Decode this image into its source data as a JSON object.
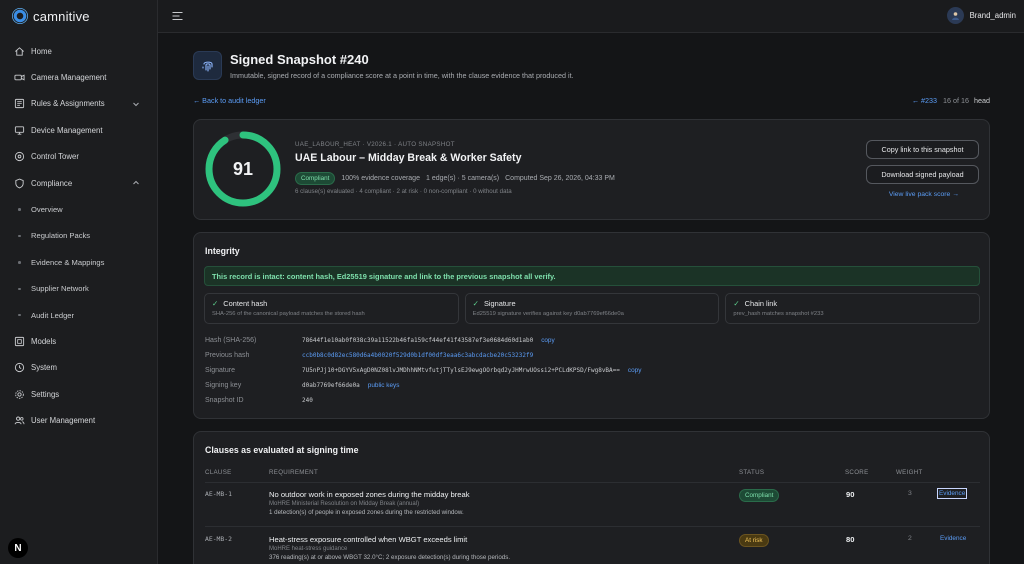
{
  "brand": {
    "name": "camnitive"
  },
  "sidebar": {
    "items": [
      {
        "label": "Home",
        "icon": "home-icon"
      },
      {
        "label": "Camera Management",
        "icon": "camera-icon"
      },
      {
        "label": "Rules & Assignments",
        "icon": "rules-icon",
        "expandable": true
      },
      {
        "label": "Device Management",
        "icon": "device-icon"
      },
      {
        "label": "Control Tower",
        "icon": "control-tower-icon"
      },
      {
        "label": "Compliance",
        "icon": "shield-icon",
        "expanded": true
      },
      {
        "label": "Models",
        "icon": "models-icon"
      },
      {
        "label": "System",
        "icon": "system-icon"
      },
      {
        "label": "Settings",
        "icon": "gear-icon"
      },
      {
        "label": "User Management",
        "icon": "users-icon"
      }
    ],
    "compliance_sub": [
      "Overview",
      "Regulation Packs",
      "Evidence & Mappings",
      "Supplier Network",
      "Audit Ledger"
    ],
    "badge": "N"
  },
  "topbar": {
    "user": "Brand_admin"
  },
  "page": {
    "title": "Signed Snapshot #240",
    "subtitle": "Immutable, signed record of a compliance score at a point in time, with the clause evidence that produced it.",
    "back": "← Back to audit ledger",
    "pager": {
      "prev": "← #233",
      "position": "16 of 16",
      "head": "head"
    }
  },
  "snapshot": {
    "score": "91",
    "score_fraction": 0.91,
    "pack_code": "UAE_LABOUR_HEAT · V2026.1 · AUTO SNAPSHOT",
    "pack_title": "UAE Labour – Midday Break & Worker Safety",
    "status": "Compliant",
    "coverage": "100% evidence coverage",
    "edges": "1 edge(s) · 5 camera(s)",
    "computed": "Computed Sep 26, 2026, 04:33 PM",
    "counts": "6 clause(s) evaluated · 4 compliant · 2 at risk · 0 non-compliant · 0 without data",
    "copy_link": "Copy link to this snapshot",
    "download": "Download signed payload",
    "live_link": "View live pack score →"
  },
  "integrity": {
    "title": "Integrity",
    "banner": "This record is intact: content hash, Ed25519 signature and link to the previous snapshot all verify.",
    "checks": [
      {
        "title": "Content hash",
        "desc": "SHA-256 of the canonical payload matches the stored hash"
      },
      {
        "title": "Signature",
        "desc": "Ed25519 signature verifies against key d0ab7769ef66de0a"
      },
      {
        "title": "Chain link",
        "desc": "prev_hash matches snapshot #233"
      }
    ],
    "fields": [
      {
        "k": "Hash (SHA-256)",
        "v": "78644f1e10ab0f038c39a11522b46fa159cf44ef41f43587ef3e0684d60d1ab0",
        "act": "copy"
      },
      {
        "k": "Previous hash",
        "v": "ccb0b8c0d82ec580d6a4b0020f529d0b1df00df3eaa6c3abcdacbe20c53232f9",
        "link": true
      },
      {
        "k": "Signature",
        "v": "7U5nPJj10+DGYV5xAgD0NZ08lvJMDhhNMtvfutjTTylsEJ9ewgOOrbqd2yJHMrwUOssi2+PCLdKPSD/Fwg8vBA==",
        "act": "copy"
      },
      {
        "k": "Signing key",
        "v": "d0ab7769ef66de0a",
        "act": "public keys"
      },
      {
        "k": "Snapshot ID",
        "v": "240"
      }
    ]
  },
  "clauses": {
    "title": "Clauses as evaluated at signing time",
    "headers": [
      "CLAUSE",
      "REQUIREMENT",
      "STATUS",
      "SCORE",
      "WEIGHT"
    ],
    "rows": [
      {
        "id": "AE-MB-1",
        "title": "No outdoor work in exposed zones during the midday break",
        "source": "MoHRE Ministerial Resolution on Midday Break (annual)",
        "note": "1 detection(s) of people in exposed zones during the restricted window.",
        "status": "Compliant",
        "score": "90",
        "weight": "3",
        "evidence": "Evidence"
      },
      {
        "id": "AE-MB-2",
        "title": "Heat-stress exposure controlled when WBGT exceeds limit",
        "source": "MoHRE heat-stress guidance",
        "note": "376 reading(s) at or above WBGT 32.0°C; 2 exposure detection(s) during those periods.",
        "status": "At risk",
        "score": "80",
        "weight": "2",
        "evidence": "Evidence"
      }
    ]
  },
  "colors": {
    "accent": "#5b9cf5",
    "ring": "#2ec27e",
    "compliant": "#7ee0ac",
    "at_risk": "#f2c45a"
  }
}
